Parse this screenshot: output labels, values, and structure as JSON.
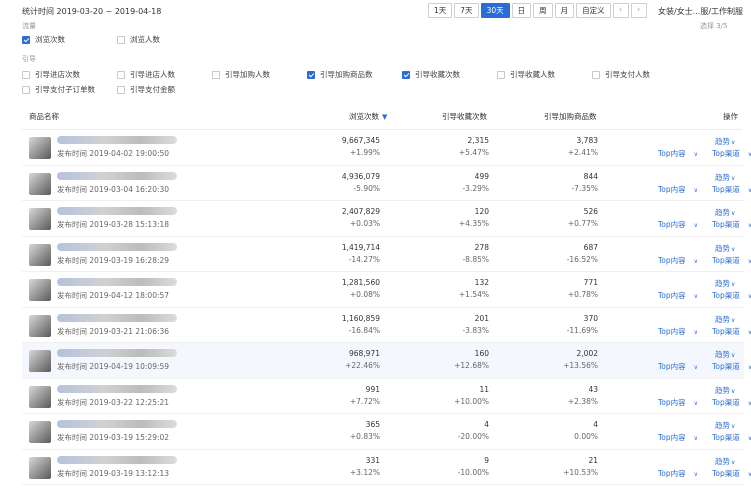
{
  "header": {
    "stat_time": "统计时间 2019-03-20 ~ 2019-04-18",
    "periods": [
      "1天",
      "7天",
      "30天",
      "日",
      "周",
      "月",
      "自定义"
    ],
    "active_period": "30天",
    "category": "女装/女士...服/工作制服",
    "select_count": "选择 3/5"
  },
  "filters": {
    "cut_label": "流量",
    "traffic": [
      {
        "label": "浏览次数",
        "checked": true
      },
      {
        "label": "浏览人数",
        "checked": false
      }
    ],
    "guide_label": "引导",
    "guide_row1": [
      {
        "label": "引导进店次数",
        "checked": false
      },
      {
        "label": "引导进店人数",
        "checked": false
      },
      {
        "label": "引导加购人数",
        "checked": false
      },
      {
        "label": "引导加购商品数",
        "checked": true
      },
      {
        "label": "引导收藏次数",
        "checked": true
      },
      {
        "label": "引导收藏人数",
        "checked": false
      },
      {
        "label": "引导支付人数",
        "checked": false
      }
    ],
    "guide_row2": [
      {
        "label": "引导支付子订单数",
        "checked": false
      },
      {
        "label": "引导支付金额",
        "checked": false
      }
    ]
  },
  "table": {
    "headers": {
      "product": "商品名称",
      "views": "浏览次数",
      "favorites": "引导收藏次数",
      "cart": "引导加购商品数",
      "ops": "操作"
    },
    "op_labels": {
      "trend": "趋势",
      "top_content": "Top内容",
      "top_channel": "Top渠道"
    },
    "rows": [
      {
        "time": "发布时间 2019-04-02 19:00:50",
        "views": "9,667,345",
        "views_pct": "+1.99%",
        "fav": "2,315",
        "fav_pct": "+5.47%",
        "cart": "3,783",
        "cart_pct": "+2.41%"
      },
      {
        "time": "发布时间 2019-03-04 16:20:30",
        "views": "4,936,079",
        "views_pct": "-5.90%",
        "fav": "499",
        "fav_pct": "-3.29%",
        "cart": "844",
        "cart_pct": "-7.35%"
      },
      {
        "time": "发布时间 2019-03-28 15:13:18",
        "views": "2,407,829",
        "views_pct": "+0.03%",
        "fav": "120",
        "fav_pct": "+4.35%",
        "cart": "526",
        "cart_pct": "+0.77%"
      },
      {
        "time": "发布时间 2019-03-19 16:28:29",
        "views": "1,419,714",
        "views_pct": "-14.27%",
        "fav": "278",
        "fav_pct": "-8.85%",
        "cart": "687",
        "cart_pct": "-16.52%"
      },
      {
        "time": "发布时间 2019-04-12 18:00:57",
        "views": "1,281,560",
        "views_pct": "+0.08%",
        "fav": "132",
        "fav_pct": "+1.54%",
        "cart": "771",
        "cart_pct": "+0.78%"
      },
      {
        "time": "发布时间 2019-03-21 21:06:36",
        "views": "1,160,859",
        "views_pct": "-16.84%",
        "fav": "201",
        "fav_pct": "-3.83%",
        "cart": "370",
        "cart_pct": "-11.69%"
      },
      {
        "time": "发布时间 2019-04-19 10:09:59",
        "views": "968,971",
        "views_pct": "+22.46%",
        "fav": "160",
        "fav_pct": "+12.68%",
        "cart": "2,002",
        "cart_pct": "+13.56%"
      },
      {
        "time": "发布时间 2019-03-22 12:25:21",
        "views": "991",
        "views_pct": "+7.72%",
        "fav": "11",
        "fav_pct": "+10.00%",
        "cart": "43",
        "cart_pct": "+2.38%"
      },
      {
        "time": "发布时间 2019-03-19 15:29:02",
        "views": "365",
        "views_pct": "+0.83%",
        "fav": "4",
        "fav_pct": "-20.00%",
        "cart": "4",
        "cart_pct": "0.00%"
      },
      {
        "time": "发布时间 2019-03-19 13:12:13",
        "views": "331",
        "views_pct": "+3.12%",
        "fav": "9",
        "fav_pct": "-10.00%",
        "cart": "21",
        "cart_pct": "+10.53%"
      }
    ]
  },
  "colors": {
    "accent": "#2a6cd6",
    "highlight_row": "#f4f8fe"
  }
}
